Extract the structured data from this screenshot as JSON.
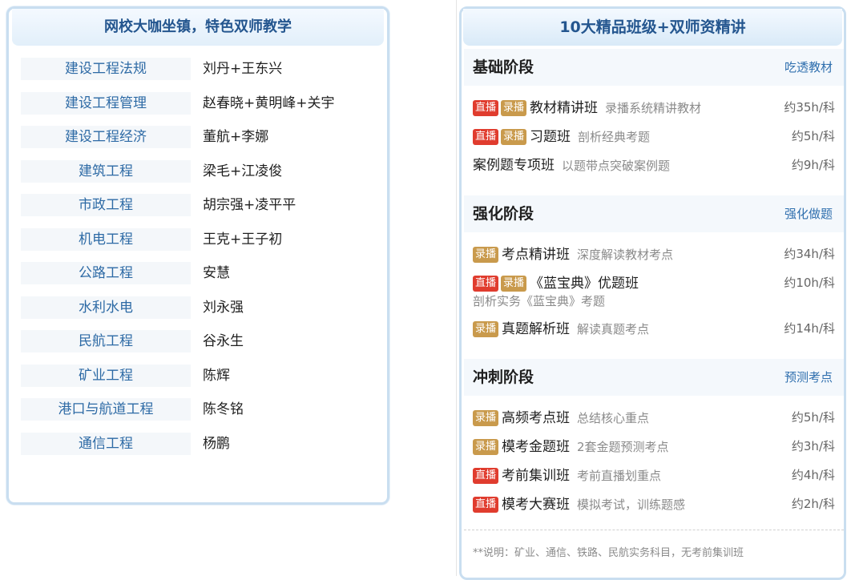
{
  "left": {
    "title": "网校大咖坐镇，特色双师教学",
    "teachers": [
      {
        "subject": "建设工程法规",
        "names": "刘丹+王东兴"
      },
      {
        "subject": "建设工程管理",
        "names": "赵春晓+黄明峰+关宇"
      },
      {
        "subject": "建设工程经济",
        "names": "董航+李娜"
      },
      {
        "subject": "建筑工程",
        "names": "梁毛+江凌俊"
      },
      {
        "subject": "市政工程",
        "names": "胡宗强+凌平平"
      },
      {
        "subject": "机电工程",
        "names": "王克+王子初"
      },
      {
        "subject": "公路工程",
        "names": "安慧"
      },
      {
        "subject": "水利水电",
        "names": "刘永强"
      },
      {
        "subject": "民航工程",
        "names": "谷永生"
      },
      {
        "subject": "矿业工程",
        "names": "陈辉"
      },
      {
        "subject": "港口与航道工程",
        "names": "陈冬铭"
      },
      {
        "subject": "通信工程",
        "names": "杨鹏"
      }
    ]
  },
  "right": {
    "title": "10大精品班级+双师资精讲",
    "badges": {
      "live": "直播",
      "rec": "录播"
    },
    "stages": [
      {
        "title": "基础阶段",
        "tag": "吃透教材",
        "courses": [
          {
            "live": true,
            "rec": true,
            "name": "教材精讲班",
            "desc": "录播系统精讲教材",
            "hours": "约35h/科"
          },
          {
            "live": true,
            "rec": true,
            "name": "习题班",
            "desc": "剖析经典考题",
            "hours": "约5h/科"
          },
          {
            "live": false,
            "rec": false,
            "name": "案例题专项班",
            "desc": "以题带点突破案例题",
            "hours": "约9h/科"
          }
        ]
      },
      {
        "title": "强化阶段",
        "tag": "强化做题",
        "courses": [
          {
            "live": false,
            "rec": true,
            "name": "考点精讲班",
            "desc": "深度解读教材考点",
            "hours": "约34h/科"
          },
          {
            "live": true,
            "rec": true,
            "name": "《蓝宝典》优题班",
            "desc": "剖析实务《蓝宝典》考题",
            "hours": "约10h/科"
          },
          {
            "live": false,
            "rec": true,
            "name": "真题解析班",
            "desc": "解读真题考点",
            "hours": "约14h/科"
          }
        ]
      },
      {
        "title": "冲刺阶段",
        "tag": "预测考点",
        "courses": [
          {
            "live": false,
            "rec": true,
            "name": "高频考点班",
            "desc": "总结核心重点",
            "hours": "约5h/科"
          },
          {
            "live": false,
            "rec": true,
            "name": "模考金题班",
            "desc": "2套金题预测考点",
            "hours": "约3h/科"
          },
          {
            "live": true,
            "rec": false,
            "name": "考前集训班",
            "desc": "考前直播划重点",
            "hours": "约4h/科"
          },
          {
            "live": true,
            "rec": false,
            "name": "模考大赛班",
            "desc": "模拟考试，训练题感",
            "hours": "约2h/科"
          }
        ]
      }
    ],
    "note": "**说明：矿业、通信、铁路、民航实务科目，无考前集训班"
  },
  "colors": {
    "accent": "#24568f",
    "live": "#e03c2e",
    "rec": "#c99a4c",
    "link": "#2f6fae"
  }
}
